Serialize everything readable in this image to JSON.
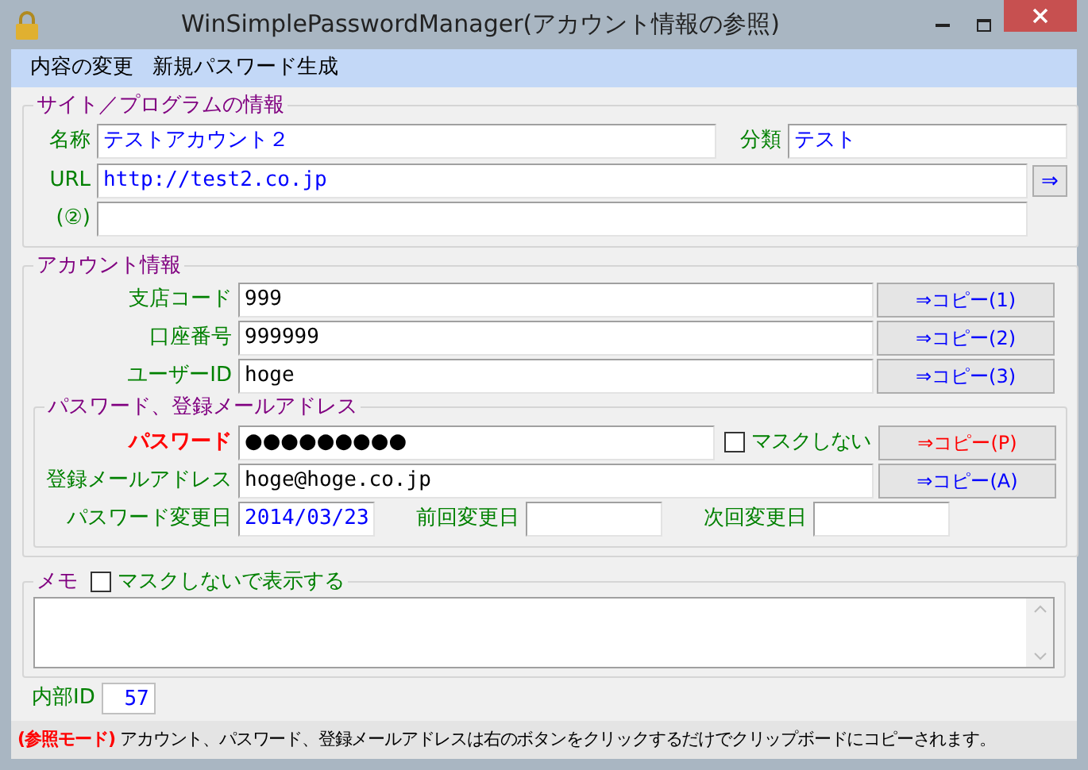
{
  "window": {
    "title": "WinSimplePasswordManager(アカウント情報の参照)"
  },
  "menu": [
    "内容の変更",
    "新規パスワード生成"
  ],
  "site_info": {
    "legend": "サイト／プログラムの情報",
    "name": {
      "label": "名称",
      "value": "テストアカウント２"
    },
    "category": {
      "label": "分類",
      "value": "テスト"
    },
    "url": {
      "label": "URL",
      "value": "http://test2.co.jp",
      "button": "⇒"
    },
    "url2": {
      "label": "(②)"
    }
  },
  "account": {
    "legend": "アカウント情報",
    "rows": [
      {
        "label": "支店コード",
        "value": "999",
        "button": "⇒コピー(1)"
      },
      {
        "label": "口座番号",
        "value": "999999",
        "button": "⇒コピー(2)"
      },
      {
        "label": "ユーザーID",
        "value": "hoge",
        "button": "⇒コピー(3)"
      }
    ],
    "password_section": {
      "legend": "パスワード、登録メールアドレス",
      "password": {
        "label": "パスワード",
        "value": "●●●●●●●●●",
        "unmask": {
          "label": "マスクしない",
          "checked": false
        },
        "button": "⇒コピー(P)"
      },
      "email": {
        "label": "登録メールアドレス",
        "value": "hoge@hoge.co.jp",
        "button": "⇒コピー(A)"
      },
      "dates": [
        {
          "label": "パスワード変更日",
          "value": "2014/03/23"
        },
        {
          "label": "前回変更日"
        },
        {
          "label": "次回変更日"
        }
      ]
    }
  },
  "memo": {
    "legend": "メモ",
    "unmask": {
      "label": "マスクしないで表示する",
      "checked": false
    }
  },
  "internal_id": {
    "label": "内部ID",
    "value": "57"
  },
  "status_bar": {
    "mode": "(参照モード)",
    "message": "アカウント、パスワード、登録メールアドレスは右のボタンをクリックするだけでクリップボードにコピーされます。"
  }
}
